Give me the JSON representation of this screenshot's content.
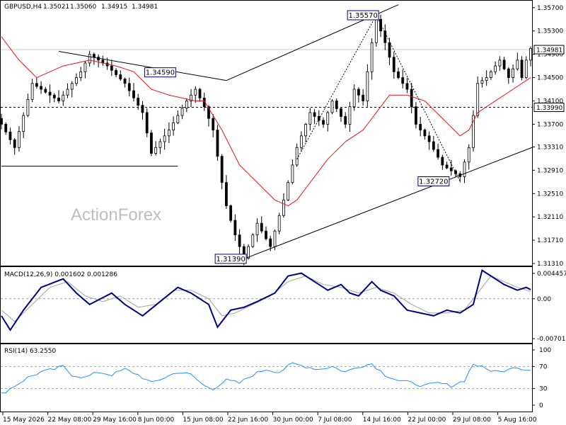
{
  "header": {
    "symbol": "GBPUSD,H4",
    "open": "1.35021",
    "high": "1.35060",
    "low": "1.34915",
    "close": "1.34981"
  },
  "watermark": "ActionForex",
  "colors": {
    "price": "#000000",
    "ma": "#e8141b",
    "macd": "#000080",
    "signal": "#a0a0a0",
    "rsi": "#1e90ff",
    "label_border": "#000080",
    "background": "#ffffff"
  },
  "chart_data": [
    {
      "type": "candlestick",
      "y_range": [
        1.3131,
        1.3571
      ],
      "y_ticks": [
        "1.35700",
        "1.35300",
        "1.34900",
        "1.34500",
        "1.34100",
        "1.33700",
        "1.33310",
        "1.32910",
        "1.32510",
        "1.32110",
        "1.31710",
        "1.31310"
      ],
      "current_price": "1.34981",
      "price_path": [
        [
          0,
          1.337
        ],
        [
          3,
          1.333
        ],
        [
          7,
          1.344
        ],
        [
          13,
          1.341
        ],
        [
          18,
          1.346
        ],
        [
          20,
          1.349
        ],
        [
          24,
          1.347
        ],
        [
          28,
          1.344
        ],
        [
          32,
          1.339
        ],
        [
          34,
          1.332
        ],
        [
          38,
          1.336
        ],
        [
          42,
          1.341
        ],
        [
          44,
          1.343
        ],
        [
          46,
          1.34
        ],
        [
          48,
          1.336
        ],
        [
          50,
          1.327
        ],
        [
          51,
          1.323
        ],
        [
          53,
          1.318
        ],
        [
          55,
          1.314
        ],
        [
          58,
          1.32
        ],
        [
          61,
          1.316
        ],
        [
          64,
          1.324
        ],
        [
          67,
          1.333
        ],
        [
          70,
          1.339
        ],
        [
          73,
          1.337
        ],
        [
          75,
          1.341
        ],
        [
          78,
          1.337
        ],
        [
          80,
          1.343
        ],
        [
          82,
          1.341
        ],
        [
          84,
          1.351
        ],
        [
          85,
          1.355
        ],
        [
          87,
          1.351
        ],
        [
          89,
          1.346
        ],
        [
          92,
          1.343
        ],
        [
          94,
          1.337
        ],
        [
          97,
          1.334
        ],
        [
          100,
          1.33
        ],
        [
          102,
          1.329
        ],
        [
          104,
          1.328
        ],
        [
          106,
          1.333
        ],
        [
          108,
          1.344
        ],
        [
          110,
          1.345
        ],
        [
          113,
          1.348
        ],
        [
          115,
          1.345
        ],
        [
          117,
          1.348
        ],
        [
          118,
          1.345
        ],
        [
          119,
          1.348
        ],
        [
          120,
          1.35
        ]
      ],
      "ma_path": [
        [
          0,
          1.352
        ],
        [
          4,
          1.348
        ],
        [
          8,
          1.345
        ],
        [
          14,
          1.347
        ],
        [
          20,
          1.348
        ],
        [
          26,
          1.347
        ],
        [
          30,
          1.346
        ],
        [
          34,
          1.343
        ],
        [
          38,
          1.342
        ],
        [
          44,
          1.341
        ],
        [
          46,
          1.341
        ],
        [
          50,
          1.336
        ],
        [
          54,
          1.33
        ],
        [
          58,
          1.327
        ],
        [
          62,
          1.324
        ],
        [
          65,
          1.323
        ],
        [
          67,
          1.324
        ],
        [
          70,
          1.327
        ],
        [
          74,
          1.331
        ],
        [
          78,
          1.334
        ],
        [
          82,
          1.336
        ],
        [
          84,
          1.338
        ],
        [
          86,
          1.34
        ],
        [
          88,
          1.342
        ],
        [
          92,
          1.342
        ],
        [
          96,
          1.341
        ],
        [
          100,
          1.338
        ],
        [
          104,
          1.335
        ],
        [
          106,
          1.336
        ],
        [
          108,
          1.339
        ],
        [
          112,
          1.341
        ],
        [
          116,
          1.343
        ],
        [
          120,
          1.345
        ]
      ],
      "trendlines": [
        {
          "from": [
            13,
            1.3495
          ],
          "to": [
            51,
            1.3445
          ]
        },
        {
          "from": [
            51,
            1.3445
          ],
          "to": [
            90,
            1.3575
          ]
        },
        {
          "from": [
            0,
            1.3298
          ],
          "to": [
            40,
            1.3298
          ]
        },
        {
          "from": [
            55,
            1.3139
          ],
          "to": [
            122,
            1.3335
          ]
        }
      ],
      "dotted_lines": [
        {
          "from": [
            67,
            1.331
          ],
          "to": [
            85,
            1.3557
          ]
        },
        {
          "from": [
            85,
            1.3557
          ],
          "to": [
            104,
            1.3272
          ]
        }
      ],
      "horizontal_levels": [
        {
          "value": 1.3399,
          "label": "1.33990",
          "style": "dashed"
        },
        {
          "value": 1.3498,
          "label": "1.34981",
          "style": "solid-light"
        }
      ],
      "price_labels": [
        {
          "x": 36,
          "value": 1.3459,
          "text": "1.34590"
        },
        {
          "x": 82,
          "value": 1.3557,
          "text": "1.35570"
        },
        {
          "x": 98,
          "value": 1.3272,
          "text": "1.32720"
        },
        {
          "x": 52,
          "value": 1.3139,
          "text": "1.31390"
        }
      ],
      "x_ticks": [
        "15 May 2026",
        "22 May 08:00",
        "29 May 16:00",
        "8 Jun 00:00",
        "15 Jun 08:00",
        "22 Jun 16:00",
        "30 Jun 00:00",
        "7 Jul 08:00",
        "14 Jul 16:00",
        "22 Jul 00:00",
        "29 Jul 08:00",
        "5 Aug 16:00"
      ]
    },
    {
      "type": "line",
      "title": "MACD(12,26,9) 0.001602 0.001286",
      "y_range": [
        -0.0075,
        0.0052
      ],
      "y_ticks": [
        "0.004457",
        "0.00",
        "-0.007014"
      ],
      "macd": [
        [
          0,
          -0.003
        ],
        [
          2,
          -0.0055
        ],
        [
          5,
          -0.002
        ],
        [
          9,
          0.002
        ],
        [
          14,
          0.0035
        ],
        [
          17,
          0.001
        ],
        [
          20,
          -0.001
        ],
        [
          25,
          0.001
        ],
        [
          28,
          -0.001
        ],
        [
          32,
          -0.003
        ],
        [
          36,
          -0.0005
        ],
        [
          40,
          0.002
        ],
        [
          43,
          0.001
        ],
        [
          47,
          -0.001
        ],
        [
          49,
          -0.005
        ],
        [
          52,
          -0.002
        ],
        [
          55,
          -0.0015
        ],
        [
          58,
          -0.0005
        ],
        [
          62,
          0.001
        ],
        [
          65,
          0.004
        ],
        [
          68,
          0.0045
        ],
        [
          71,
          0.003
        ],
        [
          74,
          0.0015
        ],
        [
          77,
          0.0025
        ],
        [
          79,
          0.001
        ],
        [
          81,
          0.0005
        ],
        [
          84,
          0.003
        ],
        [
          86,
          0.0015
        ],
        [
          89,
          0.0005
        ],
        [
          92,
          -0.002
        ],
        [
          95,
          -0.0025
        ],
        [
          98,
          -0.003
        ],
        [
          101,
          -0.002
        ],
        [
          104,
          -0.0025
        ],
        [
          107,
          -0.001
        ],
        [
          109,
          0.005
        ],
        [
          111,
          0.004
        ],
        [
          114,
          0.0025
        ],
        [
          117,
          0.0015
        ],
        [
          119,
          0.002
        ],
        [
          120,
          0.0016
        ]
      ],
      "signal": [
        [
          0,
          -0.002
        ],
        [
          3,
          -0.004
        ],
        [
          7,
          -0.001
        ],
        [
          11,
          0.002
        ],
        [
          15,
          0.003
        ],
        [
          19,
          0.0005
        ],
        [
          23,
          -0.0005
        ],
        [
          27,
          0.0005
        ],
        [
          31,
          -0.0015
        ],
        [
          35,
          -0.001
        ],
        [
          39,
          0.0015
        ],
        [
          43,
          0.0015
        ],
        [
          47,
          0.0
        ],
        [
          50,
          -0.003
        ],
        [
          53,
          -0.0025
        ],
        [
          57,
          -0.001
        ],
        [
          61,
          0.0005
        ],
        [
          65,
          0.003
        ],
        [
          69,
          0.004
        ],
        [
          73,
          0.0025
        ],
        [
          77,
          0.002
        ],
        [
          81,
          0.001
        ],
        [
          85,
          0.002
        ],
        [
          89,
          0.001
        ],
        [
          93,
          -0.001
        ],
        [
          97,
          -0.0025
        ],
        [
          101,
          -0.0025
        ],
        [
          105,
          -0.002
        ],
        [
          108,
          0.001
        ],
        [
          111,
          0.004
        ],
        [
          114,
          0.003
        ],
        [
          117,
          0.002
        ],
        [
          120,
          0.0013
        ]
      ]
    },
    {
      "type": "line",
      "title": "RSI(14) 63.2550",
      "y_range": [
        0,
        100
      ],
      "y_ticks": [
        "100",
        "70",
        "30",
        "0"
      ],
      "levels": [
        70,
        30
      ],
      "rsi": [
        [
          0,
          20
        ],
        [
          3,
          35
        ],
        [
          6,
          50
        ],
        [
          9,
          60
        ],
        [
          12,
          65
        ],
        [
          14,
          70
        ],
        [
          16,
          55
        ],
        [
          19,
          50
        ],
        [
          22,
          60
        ],
        [
          25,
          55
        ],
        [
          28,
          65
        ],
        [
          31,
          55
        ],
        [
          34,
          40
        ],
        [
          37,
          50
        ],
        [
          40,
          60
        ],
        [
          43,
          55
        ],
        [
          46,
          35
        ],
        [
          48,
          30
        ],
        [
          51,
          45
        ],
        [
          54,
          40
        ],
        [
          57,
          55
        ],
        [
          60,
          65
        ],
        [
          63,
          60
        ],
        [
          66,
          75
        ],
        [
          69,
          70
        ],
        [
          72,
          65
        ],
        [
          75,
          70
        ],
        [
          78,
          60
        ],
        [
          81,
          70
        ],
        [
          84,
          75
        ],
        [
          87,
          55
        ],
        [
          90,
          45
        ],
        [
          93,
          40
        ],
        [
          96,
          35
        ],
        [
          99,
          40
        ],
        [
          102,
          35
        ],
        [
          105,
          45
        ],
        [
          107,
          75
        ],
        [
          110,
          65
        ],
        [
          113,
          60
        ],
        [
          116,
          70
        ],
        [
          119,
          65
        ],
        [
          120,
          63
        ]
      ]
    }
  ]
}
